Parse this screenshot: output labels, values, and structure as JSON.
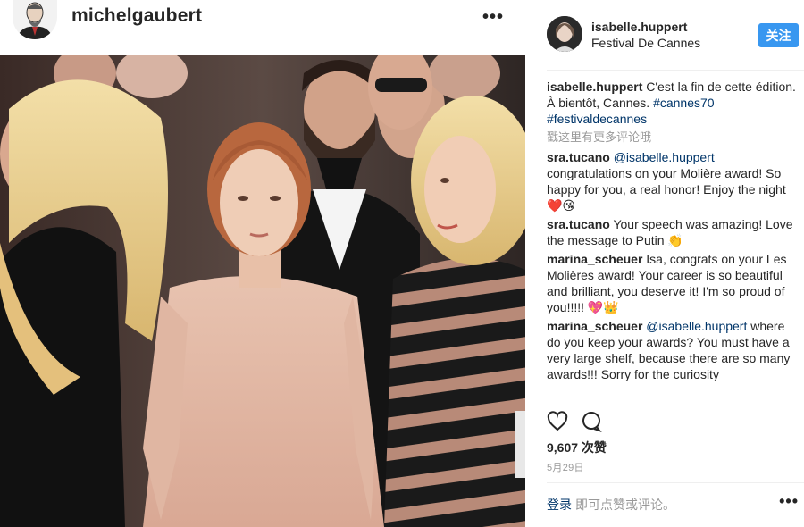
{
  "post_author": {
    "username": "michelgaubert"
  },
  "post_owner": {
    "username": "isabelle.huppert",
    "location": "Festival De Cannes",
    "follow_label": "关注"
  },
  "caption": {
    "username": "isabelle.huppert",
    "text": "C'est la fin de cette édition. À bientôt, Cannes. ",
    "hashtag1": "#cannes70",
    "hashtag2": "#festivaldecannes"
  },
  "more_comments_label": "戳这里有更多评论哦",
  "comments": [
    {
      "username": "sra.tucano",
      "mention": "@isabelle.huppert",
      "text": " congratulations on your Molière award! So happy for you, a real honor! Enjoy the night ❤️😘"
    },
    {
      "username": "sra.tucano",
      "mention": "",
      "text": "Your speech was amazing! Love the message to Putin 👏"
    },
    {
      "username": "marina_scheuer",
      "mention": "",
      "text": "Isa, congrats on your Les Molières award! Your career is so beautiful and brilliant, you deserve it! I'm so proud of you!!!!! 💖👑"
    },
    {
      "username": "marina_scheuer",
      "mention": "@isabelle.huppert",
      "text": " where do you keep your awards? You must have a very large shelf, because there are so many awards!!! Sorry for the curiosity"
    }
  ],
  "likes": "9,607 次赞",
  "date": "5月29日",
  "bottom": {
    "login_label": "登录",
    "comment_prompt": "即可点赞或评论。"
  },
  "icons": {
    "like": "heart-icon",
    "comment": "comment-bubble-icon",
    "more": "more-dots-icon"
  },
  "colors": {
    "follow_button": "#3897f0",
    "link": "#003569",
    "muted": "#999999"
  }
}
